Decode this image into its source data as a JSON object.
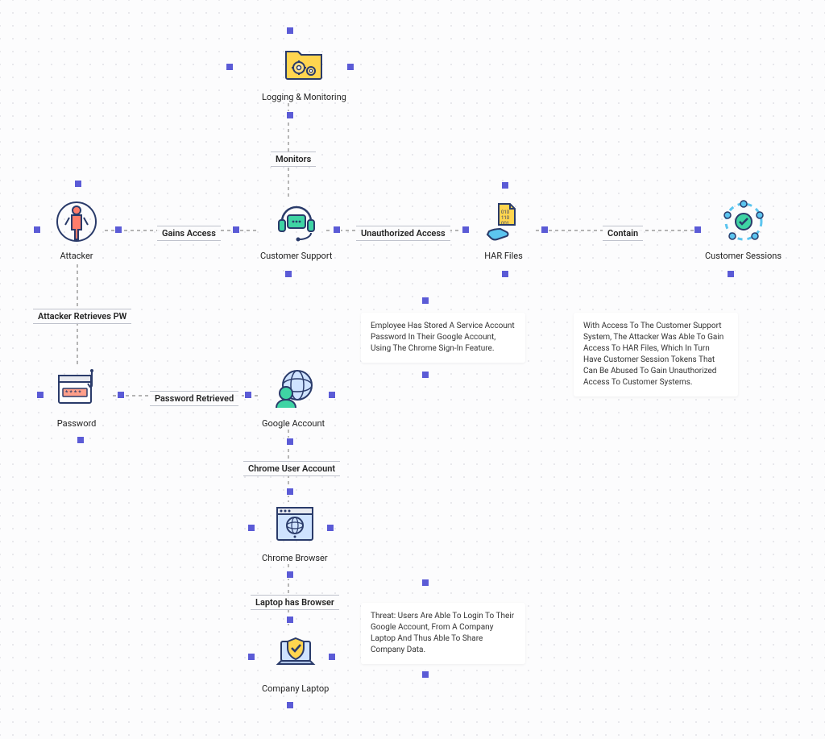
{
  "nodes": {
    "logging": {
      "label": "Logging & Monitoring"
    },
    "attacker": {
      "label": "Attacker"
    },
    "customer_support": {
      "label": "Customer Support"
    },
    "har_files": {
      "label": "HAR Files"
    },
    "customer_sessions": {
      "label": "Customer Sessions"
    },
    "password": {
      "label": "Password"
    },
    "google_account": {
      "label": "Google Account"
    },
    "chrome_browser": {
      "label": "Chrome Browser"
    },
    "company_laptop": {
      "label": "Company Laptop"
    }
  },
  "edges": {
    "monitors": {
      "label": "Monitors"
    },
    "gains_access": {
      "label": "Gains Access"
    },
    "unauthorized_access": {
      "label": "Unauthorized Access"
    },
    "contain": {
      "label": "Contain"
    },
    "attacker_retrieves_pw": {
      "label": "Attacker Retrieves PW"
    },
    "password_retrieved": {
      "label": "Password Retrieved"
    },
    "chrome_user_account": {
      "label": "Chrome User Account"
    },
    "laptop_has_browser": {
      "label": "Laptop has Browser"
    }
  },
  "notes": {
    "note1": "Employee Has Stored A Service Account Password In Their Google Account, Using The Chrome Sign-In Feature.",
    "note2": "With Access To The Customer Support System, The Attacker Was Able To Gain Access To HAR Files, Which In Turn Have Customer Session Tokens That Can Be Abused To Gain Unauthorized Access To Customer Systems.",
    "note3": "Threat: Users Are Able To Login To Their Google Account, From A Company Laptop And Thus Able To Share Company Data."
  },
  "colors": {
    "handle": "#5b5bd6"
  }
}
